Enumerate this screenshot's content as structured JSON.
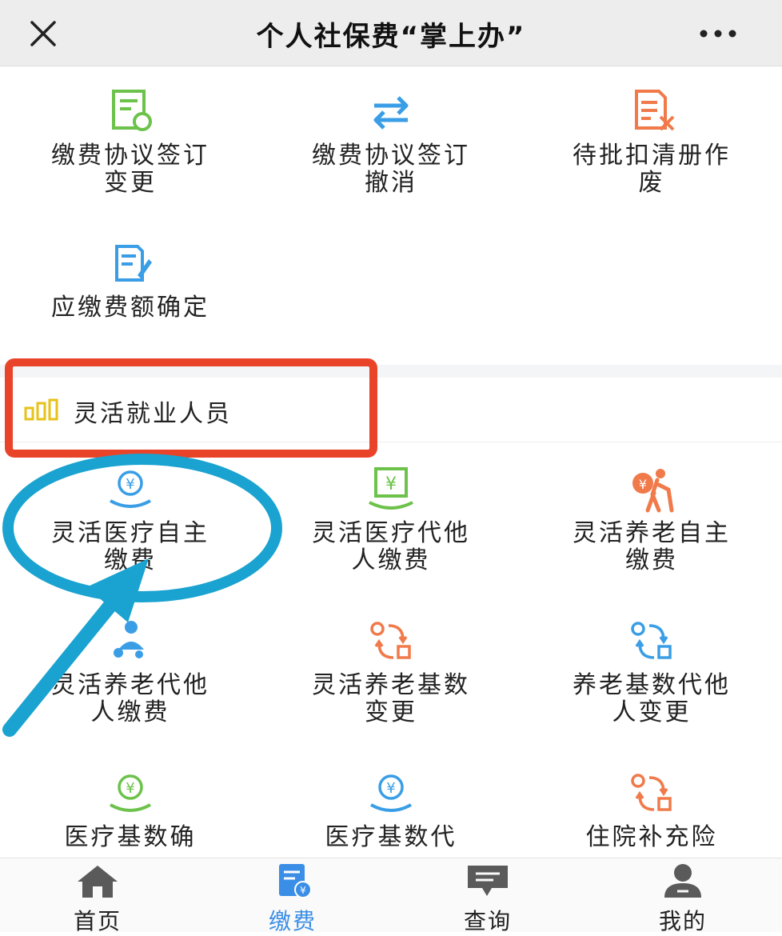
{
  "header": {
    "title": "个人社保费“掌上办”"
  },
  "top_items": [
    {
      "label": "缴费协议签订变更",
      "icon": "document-refresh-icon"
    },
    {
      "label": "缴费协议签订撤消",
      "icon": "swap-arrows-icon"
    },
    {
      "label": "待批扣清册作废",
      "icon": "document-cancel-icon"
    },
    {
      "label": "应缴费额确定",
      "icon": "document-edit-icon"
    }
  ],
  "section": {
    "title": "灵活就业人员",
    "icon": "signal-bars-icon"
  },
  "flex_items": [
    {
      "label": "灵活医疗自主缴费",
      "icon": "yuan-hand-icon"
    },
    {
      "label": "灵活医疗代他人缴费",
      "icon": "yuan-bill-hand-icon"
    },
    {
      "label": "灵活养老自主缴费",
      "icon": "elderly-person-icon"
    },
    {
      "label": "灵活养老代他人缴费",
      "icon": "elderly-family-icon"
    },
    {
      "label": "灵活养老基数变更",
      "icon": "exchange-cycle-icon"
    },
    {
      "label": "养老基数代他人变更",
      "icon": "exchange-cycle-icon"
    },
    {
      "label": "医疗基数确",
      "icon": "yuan-hand-icon"
    },
    {
      "label": "医疗基数代",
      "icon": "yuan-hand-icon"
    },
    {
      "label": "住院补充险",
      "icon": "exchange-cycle-icon"
    }
  ],
  "tabs": [
    {
      "label": "首页",
      "icon": "home-icon",
      "active": false
    },
    {
      "label": "缴费",
      "icon": "payment-document-icon",
      "active": true
    },
    {
      "label": "查询",
      "icon": "message-icon",
      "active": false
    },
    {
      "label": "我的",
      "icon": "user-icon",
      "active": false
    }
  ],
  "colors": {
    "green": "#6cc24a",
    "blue": "#3a9ee6",
    "orange": "#f07a4a",
    "yellow": "#e6c21a",
    "red_box": "#e9442a",
    "circle_annotation": "#1aa3d0",
    "active_tab": "#3a8ee6",
    "gray_icon": "#5a5a5a"
  }
}
